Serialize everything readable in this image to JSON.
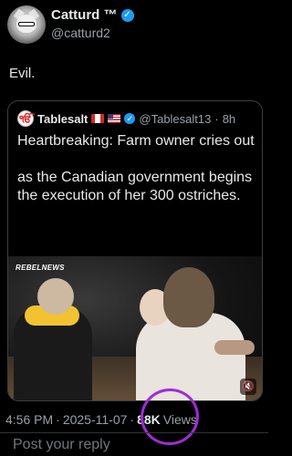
{
  "author": {
    "display_name": "Catturd ™",
    "handle": "@catturd2",
    "verified_icon": "verified-badge-icon"
  },
  "tweet": {
    "text": "Evil."
  },
  "quote": {
    "display_name": "Tablesalt",
    "avatar_letter": "ੴ",
    "flags": [
      "canada-flag-icon",
      "usa-flag-icon"
    ],
    "handle": "@Tablesalt13",
    "time": "8h",
    "text_line1": "Heartbreaking: Farm owner cries out",
    "text_line2": "as the Canadian government begins the execution of her 300 ostriches.",
    "media": {
      "logo_text": "REBELNEWS",
      "mute_icon": "speaker-muted-icon"
    }
  },
  "meta": {
    "time": "4:56 PM",
    "date": "2025-11-07",
    "separator": "·",
    "views_count": "88K",
    "views_label": "Views",
    "highlight_color": "#a12bd6"
  },
  "reply": {
    "placeholder": "Post your reply"
  },
  "colors": {
    "background": "#000000",
    "verified": "#1d9bf0",
    "secondary_text": "#9aa0a6"
  }
}
